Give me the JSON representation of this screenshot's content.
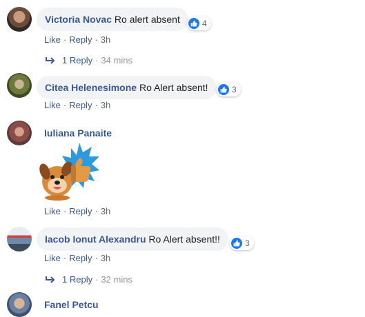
{
  "comments": [
    {
      "author": "Victoria Novac",
      "text": "Ro alert absent",
      "reactions": "4",
      "like_label": "Like",
      "reply_label": "Reply",
      "time": "3h",
      "replies": {
        "label": "1 Reply",
        "time": "34 mins"
      }
    },
    {
      "author": "Citea Helenesimone",
      "text": "Ro Alert absent!",
      "reactions": "3",
      "like_label": "Like",
      "reply_label": "Reply",
      "time": "3h"
    },
    {
      "author": "Iuliana Panaite",
      "sticker": "thumbs-up-puppy-sticker",
      "like_label": "Like",
      "reply_label": "Reply",
      "time": "3h"
    },
    {
      "author": "Iacob Ionut Alexandru",
      "text": "Ro Alert absent!!",
      "reactions": "3",
      "like_label": "Like",
      "reply_label": "Reply",
      "time": "3h",
      "replies": {
        "label": "1 Reply",
        "time": "32 mins"
      }
    },
    {
      "author": "Fanel Petcu"
    }
  ],
  "separator": "·",
  "colors": {
    "author": "#385898",
    "bubble": "#f2f3f5",
    "like_badge": "#1877f2",
    "meta": "#606770",
    "time_light": "#90949c"
  }
}
